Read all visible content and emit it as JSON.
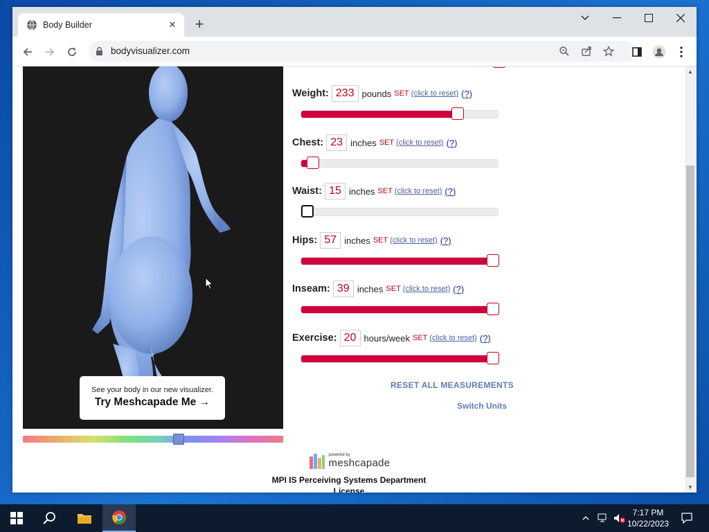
{
  "browser": {
    "tab_title": "Body Builder",
    "url": "bodyvisualizer.com"
  },
  "promo": {
    "small_text": "See your body in our new visualizer.",
    "big_text": "Try Meshcapade Me",
    "arrow": "→"
  },
  "measurements": [
    {
      "label": "Weight:",
      "value": "233",
      "unit": "pounds",
      "set": "SET",
      "reset": "(click to reset)",
      "help": "(?)",
      "level": 0.81
    },
    {
      "label": "Chest:",
      "value": "23",
      "unit": "inches",
      "set": "SET",
      "reset": "(click to reset)",
      "help": "(?)",
      "level": 0.03
    },
    {
      "label": "Waist:",
      "value": "15",
      "unit": "inches",
      "set": "SET",
      "reset": "(click to reset)",
      "help": "(?)",
      "level": 0.0
    },
    {
      "label": "Hips:",
      "value": "57",
      "unit": "inches",
      "set": "SET",
      "reset": "(click to reset)",
      "help": "(?)",
      "level": 1.0
    },
    {
      "label": "Inseam:",
      "value": "39",
      "unit": "inches",
      "set": "SET",
      "reset": "(click to reset)",
      "help": "(?)",
      "level": 1.0
    },
    {
      "label": "Exercise:",
      "value": "20",
      "unit": "hours/week",
      "set": "SET",
      "reset": "(click to reset)",
      "help": "(?)",
      "level": 1.0
    }
  ],
  "actions": {
    "reset_all": "RESET ALL MEASUREMENTS",
    "switch_units": "Switch Units"
  },
  "footer": {
    "powered_by": "powered by",
    "brand": "meshcapade",
    "department": "MPI IS Perceiving Systems Department",
    "license": "License"
  },
  "taskbar": {
    "time": "7:17 PM",
    "date": "10/22/2023"
  },
  "colors": {
    "accent": "#c0001a",
    "slider_fill": "#d0003c",
    "link": "#5d7bb8",
    "body_model": "#8fb0e8"
  }
}
